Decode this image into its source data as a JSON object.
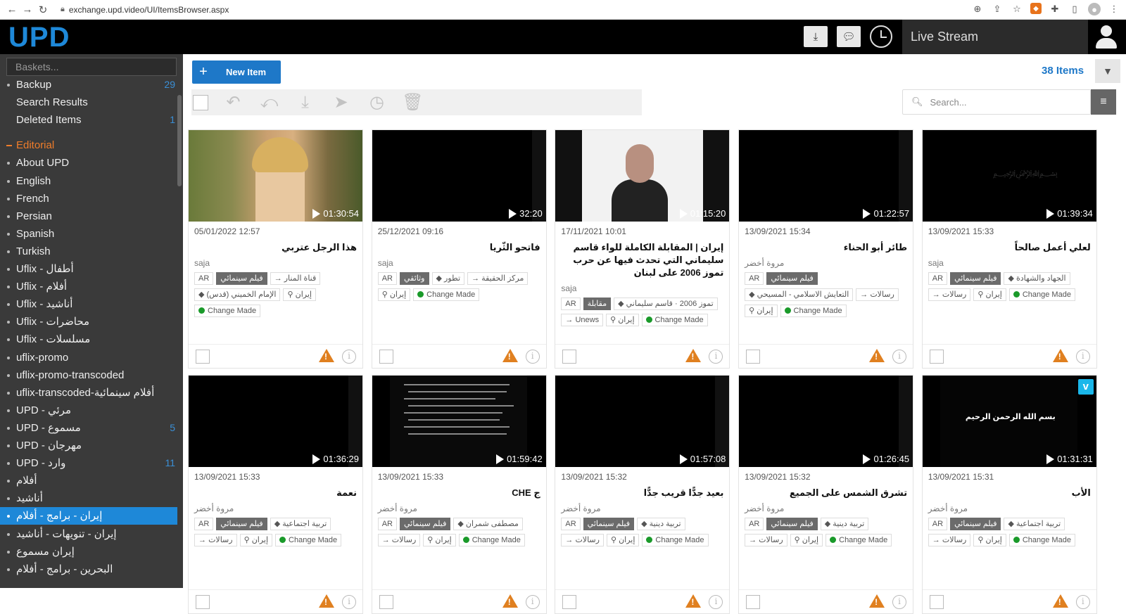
{
  "browser": {
    "url": "exchange.upd.video/UI/ItemsBrowser.aspx"
  },
  "header": {
    "logo": "UPD",
    "live_stream": "Live Stream"
  },
  "sidebar": {
    "search_placeholder": "Baskets...",
    "items": [
      {
        "label": "Backup",
        "count": "29",
        "kind": "dot"
      },
      {
        "label": "Search Results",
        "count": "",
        "kind": "plain"
      },
      {
        "label": "Deleted Items",
        "count": "1",
        "kind": "plain"
      },
      {
        "label": "Editorial",
        "count": "",
        "kind": "section"
      },
      {
        "label": "About UPD",
        "count": "",
        "kind": "dot"
      },
      {
        "label": "English",
        "count": "",
        "kind": "dot"
      },
      {
        "label": "French",
        "count": "",
        "kind": "dot"
      },
      {
        "label": "Persian",
        "count": "",
        "kind": "dot"
      },
      {
        "label": "Spanish",
        "count": "",
        "kind": "dot"
      },
      {
        "label": "Turkish",
        "count": "",
        "kind": "dot"
      },
      {
        "label": "Uflix - أطفال",
        "count": "",
        "kind": "dot"
      },
      {
        "label": "Uflix - أفلام",
        "count": "",
        "kind": "dot"
      },
      {
        "label": "Uflix - أناشيد",
        "count": "",
        "kind": "dot"
      },
      {
        "label": "Uflix - محاضرات",
        "count": "",
        "kind": "dot"
      },
      {
        "label": "Uflix - مسلسلات",
        "count": "",
        "kind": "dot"
      },
      {
        "label": "uflix-promo",
        "count": "",
        "kind": "dot"
      },
      {
        "label": "uflix-promo-transcoded",
        "count": "",
        "kind": "dot"
      },
      {
        "label": "uflix-transcoded-أفلام سينمائية",
        "count": "",
        "kind": "dot"
      },
      {
        "label": "UPD - مرئي",
        "count": "",
        "kind": "dot"
      },
      {
        "label": "UPD - مسموع",
        "count": "5",
        "kind": "dot"
      },
      {
        "label": "UPD - مهرجان",
        "count": "",
        "kind": "dot"
      },
      {
        "label": "UPD - وارد",
        "count": "11",
        "kind": "dot"
      },
      {
        "label": "أفلام",
        "count": "",
        "kind": "dot"
      },
      {
        "label": "أناشيد",
        "count": "",
        "kind": "dot"
      },
      {
        "label": "إيران - برامج - أفلام",
        "count": "",
        "kind": "active"
      },
      {
        "label": "إيران - تنويهات - أناشيد",
        "count": "",
        "kind": "dot"
      },
      {
        "label": "إيران مسموع",
        "count": "",
        "kind": "dot"
      },
      {
        "label": "البحرين - برامج - أفلام",
        "count": "",
        "kind": "dot"
      }
    ]
  },
  "main": {
    "new_item": "New Item",
    "items_count": "38 Items",
    "search_placeholder": "Search..."
  },
  "cards": [
    {
      "duration": "01:30:54",
      "date": "05/01/2022 12:57",
      "title": "هذا الرجل عتربي",
      "author": "saja",
      "tags": [
        [
          "AR",
          "lang"
        ],
        [
          "فيلم سينمائي",
          "type"
        ],
        [
          "قناة المنار",
          "arrow"
        ],
        [
          "الإمام الخميني (قدس)",
          "tag"
        ],
        [
          "إيران",
          "pin"
        ],
        [
          "Change Made",
          "status"
        ]
      ],
      "thumb": "woman"
    },
    {
      "duration": "32:20",
      "date": "25/12/2021 09:16",
      "title": "فاتحو الثّريا",
      "author": "saja",
      "tags": [
        [
          "AR",
          "lang"
        ],
        [
          "وثائقي",
          "type"
        ],
        [
          "تطور",
          "tag"
        ],
        [
          "مركز الحقيقة",
          "arrow"
        ],
        [
          "إيران",
          "pin"
        ],
        [
          "Change Made",
          "status"
        ]
      ],
      "thumb": "black"
    },
    {
      "duration": "01:15:20",
      "date": "17/11/2021 10:01",
      "title": "إيران | المقابلة الكاملة للواء قاسم سليماني التي تحدث فيها عن حرب تموز 2006 على لبنان",
      "author": "saja",
      "tags": [
        [
          "AR",
          "lang"
        ],
        [
          "مقابلة",
          "type"
        ],
        [
          "تموز 2006 · قاسم سليماني",
          "tag"
        ],
        [
          "Unews",
          "arrow"
        ],
        [
          "إيران",
          "pin"
        ],
        [
          "Change Made",
          "status"
        ]
      ],
      "thumb": "man"
    },
    {
      "duration": "01:22:57",
      "date": "13/09/2021 15:34",
      "title": "طائر أبو الحناء",
      "author": "مروة أخضر",
      "tags": [
        [
          "AR",
          "lang"
        ],
        [
          "فيلم سينمائي",
          "type"
        ],
        [
          "التعايش الاسلامي - المسيحي",
          "tag"
        ],
        [
          "رسالات",
          "arrow"
        ],
        [
          "إيران",
          "pin"
        ],
        [
          "Change Made",
          "status"
        ]
      ],
      "thumb": "black"
    },
    {
      "duration": "01:39:34",
      "date": "13/09/2021 15:33",
      "title": "لعلي أعمل صالحاً",
      "author": "saja",
      "tags": [
        [
          "AR",
          "lang"
        ],
        [
          "فيلم سينمائي",
          "type"
        ],
        [
          "الجهاد والشهادة",
          "tag"
        ],
        [
          "رسالات",
          "arrow"
        ],
        [
          "إيران",
          "pin"
        ],
        [
          "Change Made",
          "status"
        ]
      ],
      "thumb": "script"
    },
    {
      "duration": "01:36:29",
      "date": "13/09/2021 15:33",
      "title": "نعمة",
      "author": "مروة أخضر",
      "tags": [
        [
          "AR",
          "lang"
        ],
        [
          "فيلم سينمائي",
          "type"
        ],
        [
          "تربية اجتماعية",
          "tag"
        ],
        [
          "رسالات",
          "arrow"
        ],
        [
          "إيران",
          "pin"
        ],
        [
          "Change Made",
          "status"
        ]
      ],
      "thumb": "black"
    },
    {
      "duration": "01:59:42",
      "date": "13/09/2021 15:33",
      "title": "ج CHE",
      "author": "مروة أخضر",
      "tags": [
        [
          "AR",
          "lang"
        ],
        [
          "فيلم سينمائي",
          "type"
        ],
        [
          "مصطفى شمران",
          "tag"
        ],
        [
          "رسالات",
          "arrow"
        ],
        [
          "إيران",
          "pin"
        ],
        [
          "Change Made",
          "status"
        ]
      ],
      "thumb": "text"
    },
    {
      "duration": "01:57:08",
      "date": "13/09/2021 15:32",
      "title": "بعيد جدًّا قريب جدًّا",
      "author": "مروة أخضر",
      "tags": [
        [
          "AR",
          "lang"
        ],
        [
          "فيلم سينمائي",
          "type"
        ],
        [
          "تربية دينية",
          "tag"
        ],
        [
          "رسالات",
          "arrow"
        ],
        [
          "إيران",
          "pin"
        ],
        [
          "Change Made",
          "status"
        ]
      ],
      "thumb": "black"
    },
    {
      "duration": "01:26:45",
      "date": "13/09/2021 15:32",
      "title": "تشرق الشمس على الجميع",
      "author": "مروة أخضر",
      "tags": [
        [
          "AR",
          "lang"
        ],
        [
          "فيلم سينمائي",
          "type"
        ],
        [
          "تربية دينية",
          "tag"
        ],
        [
          "رسالات",
          "arrow"
        ],
        [
          "إيران",
          "pin"
        ],
        [
          "Change Made",
          "status"
        ]
      ],
      "thumb": "black"
    },
    {
      "duration": "01:31:31",
      "date": "13/09/2021 15:31",
      "title": "الأب",
      "author": "مروة أخضر",
      "tags": [
        [
          "AR",
          "lang"
        ],
        [
          "فيلم سينمائي",
          "type"
        ],
        [
          "تربية اجتماعية",
          "tag"
        ],
        [
          "رسالات",
          "arrow"
        ],
        [
          "إيران",
          "pin"
        ],
        [
          "Change Made",
          "status"
        ]
      ],
      "thumb": "basmala",
      "vimeo": "v",
      "basmala_text": "بسم الله الرحمن الرحيم"
    }
  ],
  "colors": {
    "accent": "#1e78c8",
    "warning": "#e08020",
    "status_green": "#1a9a2a",
    "sidebar_bg": "#3a3a3a"
  }
}
